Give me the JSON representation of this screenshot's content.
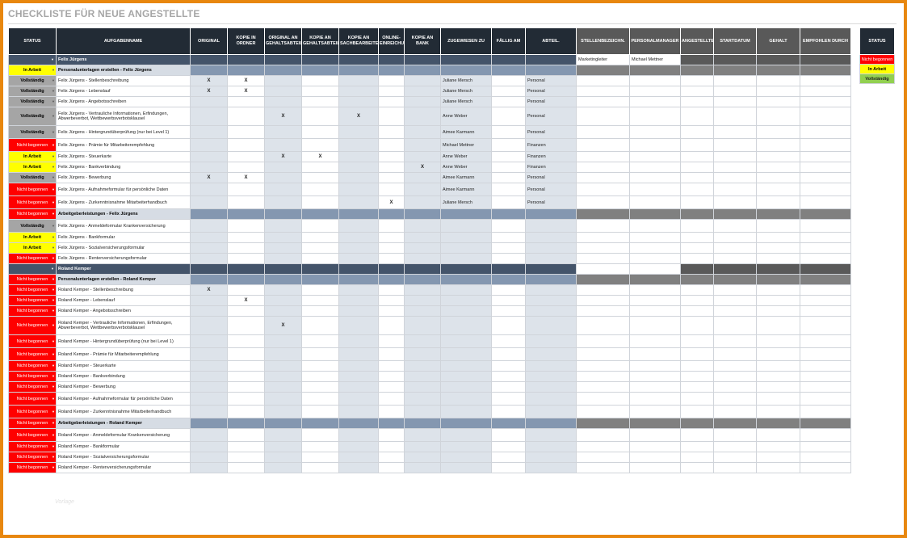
{
  "title": "CHECKLISTE FÜR NEUE ANGESTELLTE",
  "headers": [
    "STATUS",
    "AUFGABENNAME",
    "ORIGINAL",
    "KOPIE IN ORDNER",
    "ORIGINAL AN GEHALTSABTEIL.",
    "KOPIE AN GEHALTSABTEIL.",
    "KOPIE AN SACHBEARBEITER",
    "ONLINE-EINREICHUNG",
    "KOPIE AN BANK",
    "ZUGEWIESEN ZU",
    "FÄLLIG AM",
    "ABTEIL."
  ],
  "hr_headers": [
    "STELLENBEZEICHN.",
    "PERSONALMANAGER",
    "ANGESTELLTENVERHÄLTNIS",
    "STARTDATUM",
    "GEHALT",
    "EMPFOHLEN DURCH"
  ],
  "status_legend": {
    "header": "STATUS",
    "items": [
      "Nicht begonnen",
      "In Arbeit",
      "Vollständig"
    ]
  },
  "colors": {
    "header_bg": "#222b35",
    "person_bg": "#44546a",
    "section_bg": "#8497b0",
    "in_arbeit": "#ffff00",
    "vollstaendig": "#a5a5a5",
    "nicht_begonnen": "#ff0000",
    "legend_done": "#92d050",
    "frame": "#e8870e"
  },
  "watermark": "Vorlage",
  "persons": [
    {
      "name": "Felix Jürgens",
      "job_title": "Marketingleiter",
      "hr_manager": "Michael Mettner",
      "sections": [
        {
          "label": "Personalunterlagen erstellen - Felix Jürgens",
          "status": "In Arbeit",
          "tasks": [
            {
              "status": "Vollständig",
              "name": "Felix Jürgens - Stellenbeschreibung",
              "marks": [
                "X",
                "X",
                "",
                "",
                "",
                "",
                ""
              ],
              "assigned": "Juliane Mersch",
              "dept": "Personal"
            },
            {
              "status": "Vollständig",
              "name": "Felix Jürgens - Lebenslauf",
              "marks": [
                "X",
                "X",
                "",
                "",
                "",
                "",
                ""
              ],
              "assigned": "Juliane Mersch",
              "dept": "Personal"
            },
            {
              "status": "Vollständig",
              "name": "Felix Jürgens - Angebotsschreiben",
              "marks": [
                "",
                "",
                "",
                "",
                "",
                "",
                ""
              ],
              "assigned": "Juliane Mersch",
              "dept": "Personal"
            },
            {
              "status": "Vollständig",
              "name": "Felix Jürgens - Vertrauliche Informationen, Erfindungen, Abwerbeverbot, Wettbewerbsverbotsklausel",
              "marks": [
                "",
                "",
                "X",
                "",
                "X",
                "",
                ""
              ],
              "assigned": "Anne Weber",
              "dept": "Personal"
            },
            {
              "status": "Vollständig",
              "name": "Felix Jürgens - Hintergrundüberprüfung (nur bei Level 1)",
              "marks": [
                "",
                "",
                "",
                "",
                "",
                "",
                ""
              ],
              "assigned": "Aimee Karmann",
              "dept": "Personal"
            },
            {
              "status": "Nicht begonnen",
              "name": "Felix Jürgens - Prämie für Mitarbeiterempfehlung",
              "marks": [
                "",
                "",
                "",
                "",
                "",
                "",
                ""
              ],
              "assigned": "Michael Mettner",
              "dept": "Finanzen"
            },
            {
              "status": "In Arbeit",
              "name": "Felix Jürgens - Steuerkarte",
              "marks": [
                "",
                "",
                "X",
                "X",
                "",
                "",
                ""
              ],
              "assigned": "Anne Weber",
              "dept": "Finanzen"
            },
            {
              "status": "In Arbeit",
              "name": "Felix Jürgens - Bankverbindung",
              "marks": [
                "",
                "",
                "",
                "",
                "",
                "",
                "X"
              ],
              "assigned": "Anne Weber",
              "dept": "Finanzen"
            },
            {
              "status": "Vollständig",
              "name": "Felix Jürgens - Bewerbung",
              "marks": [
                "X",
                "X",
                "",
                "",
                "",
                "",
                ""
              ],
              "assigned": "Aimee Karmann",
              "dept": "Personal"
            },
            {
              "status": "Nicht begonnen",
              "name": "Felix Jürgens - Aufnahmeformular für persönliche Daten",
              "marks": [
                "",
                "",
                "",
                "",
                "",
                "",
                ""
              ],
              "assigned": "Aimee Karmann",
              "dept": "Personal"
            },
            {
              "status": "Nicht begonnen",
              "name": "Felix Jürgens - Zurkenntnisnahme Mitarbeiterhandbuch",
              "marks": [
                "",
                "",
                "",
                "",
                "",
                "X",
                ""
              ],
              "assigned": "Juliane Mersch",
              "dept": "Personal"
            }
          ]
        },
        {
          "label": "Arbeitgeberleistungen - Felix Jürgens",
          "status": "Nicht begonnen",
          "tasks": [
            {
              "status": "Vollständig",
              "name": "Felix Jürgens - Anmeldeformular Krankenversicherung",
              "marks": [
                "",
                "",
                "",
                "",
                "",
                "",
                ""
              ],
              "assigned": "",
              "dept": ""
            },
            {
              "status": "In Arbeit",
              "name": "Felix Jürgens - Bankformular",
              "marks": [
                "",
                "",
                "",
                "",
                "",
                "",
                ""
              ],
              "assigned": "",
              "dept": ""
            },
            {
              "status": "In Arbeit",
              "name": "Felix Jürgens - Sozialversicherungsformular",
              "marks": [
                "",
                "",
                "",
                "",
                "",
                "",
                ""
              ],
              "assigned": "",
              "dept": ""
            },
            {
              "status": "Nicht begonnen",
              "name": "Felix Jürgens - Rentenversicherungsformular",
              "marks": [
                "",
                "",
                "",
                "",
                "",
                "",
                ""
              ],
              "assigned": "",
              "dept": ""
            }
          ]
        }
      ]
    },
    {
      "name": "Roland Kemper",
      "job_title": "",
      "hr_manager": "",
      "sections": [
        {
          "label": "Personalunterlagen erstellen - Roland Kemper",
          "status": "Nicht begonnen",
          "tasks": [
            {
              "status": "Nicht begonnen",
              "name": "Roland Kemper - Stellenbeschreibung",
              "marks": [
                "X",
                "",
                "",
                "",
                "",
                "",
                ""
              ],
              "assigned": "",
              "dept": ""
            },
            {
              "status": "Nicht begonnen",
              "name": "Roland Kemper - Lebenslauf",
              "marks": [
                "",
                "X",
                "",
                "",
                "",
                "",
                ""
              ],
              "assigned": "",
              "dept": ""
            },
            {
              "status": "Nicht begonnen",
              "name": "Roland Kemper - Angebotsschreiben",
              "marks": [
                "",
                "",
                "",
                "",
                "",
                "",
                ""
              ],
              "assigned": "",
              "dept": ""
            },
            {
              "status": "Nicht begonnen",
              "name": "Roland Kemper - Vertrauliche Informationen, Erfindungen, Abwerbeverbot, Wettbewerbsverbotsklausel",
              "marks": [
                "",
                "",
                "X",
                "",
                "",
                "",
                ""
              ],
              "assigned": "",
              "dept": ""
            },
            {
              "status": "Nicht begonnen",
              "name": "Roland Kemper - Hintergrundüberprüfung (nur bei Level 1)",
              "marks": [
                "",
                "",
                "",
                "",
                "",
                "",
                ""
              ],
              "assigned": "",
              "dept": ""
            },
            {
              "status": "Nicht begonnen",
              "name": "Roland Kemper - Prämie für Mitarbeiterempfehlung",
              "marks": [
                "",
                "",
                "",
                "",
                "",
                "",
                ""
              ],
              "assigned": "",
              "dept": ""
            },
            {
              "status": "Nicht begonnen",
              "name": "Roland Kemper - Steuerkarte",
              "marks": [
                "",
                "",
                "",
                "",
                "",
                "",
                ""
              ],
              "assigned": "",
              "dept": ""
            },
            {
              "status": "Nicht begonnen",
              "name": "Roland Kemper - Bankverbindung",
              "marks": [
                "",
                "",
                "",
                "",
                "",
                "",
                ""
              ],
              "assigned": "",
              "dept": ""
            },
            {
              "status": "Nicht begonnen",
              "name": "Roland Kemper - Bewerbung",
              "marks": [
                "",
                "",
                "",
                "",
                "",
                "",
                ""
              ],
              "assigned": "",
              "dept": ""
            },
            {
              "status": "Nicht begonnen",
              "name": "Roland Kemper - Aufnahmeformular für persönliche Daten",
              "marks": [
                "",
                "",
                "",
                "",
                "",
                "",
                ""
              ],
              "assigned": "",
              "dept": ""
            },
            {
              "status": "Nicht begonnen",
              "name": "Roland Kemper - Zurkenntnisnahme Mitarbeiterhandbuch",
              "marks": [
                "",
                "",
                "",
                "",
                "",
                "",
                ""
              ],
              "assigned": "",
              "dept": ""
            }
          ]
        },
        {
          "label": "Arbeitgeberleistungen - Roland Kemper",
          "status": "Nicht begonnen",
          "tasks": [
            {
              "status": "Nicht begonnen",
              "name": "Roland Kemper - Anmeldeformular Krankenversicherung",
              "marks": [
                "",
                "",
                "",
                "",
                "",
                "",
                ""
              ],
              "assigned": "",
              "dept": ""
            },
            {
              "status": "Nicht begonnen",
              "name": "Roland Kemper - Bankformular",
              "marks": [
                "",
                "",
                "",
                "",
                "",
                "",
                ""
              ],
              "assigned": "",
              "dept": ""
            },
            {
              "status": "Nicht begonnen",
              "name": "Roland Kemper - Sozialversicherungsformular",
              "marks": [
                "",
                "",
                "",
                "",
                "",
                "",
                ""
              ],
              "assigned": "",
              "dept": ""
            },
            {
              "status": "Nicht begonnen",
              "name": "Roland Kemper - Rentenversicherungsformular",
              "marks": [
                "",
                "",
                "",
                "",
                "",
                "",
                ""
              ],
              "assigned": "",
              "dept": ""
            }
          ]
        }
      ]
    }
  ]
}
